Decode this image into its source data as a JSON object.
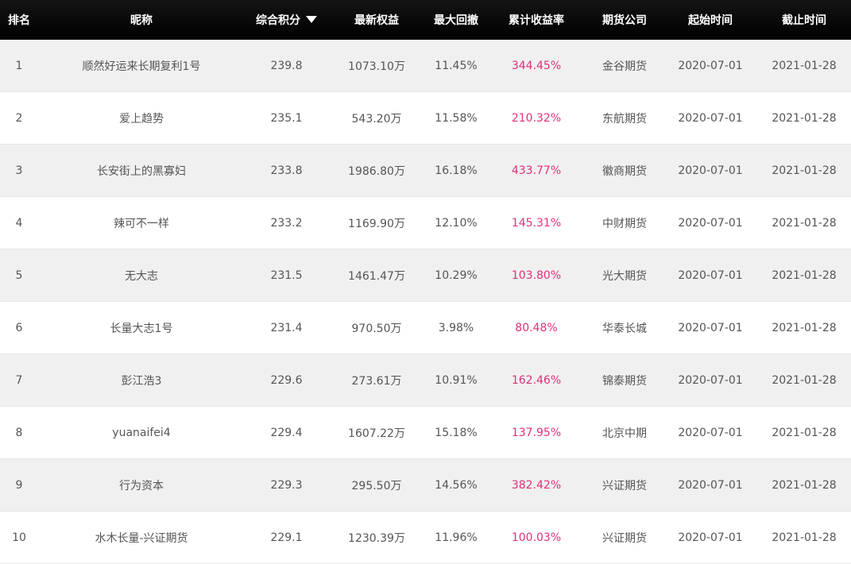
{
  "header": {
    "rank": "排名",
    "nickname": "昵称",
    "score": "综合积分",
    "equity": "最新权益",
    "drawdown": "最大回撤",
    "return": "累计收益率",
    "broker": "期货公司",
    "start": "起始时间",
    "end": "截止时间",
    "sort_icon": "caret-down-icon"
  },
  "colors": {
    "header_bg": "#000000",
    "return_text": "#e0307a",
    "stripe": "#f0f0f0"
  },
  "rows": [
    {
      "rank": "1",
      "nickname": "顺然好运来长期复利1号",
      "score": "239.8",
      "equity": "1073.10万",
      "drawdown": "11.45%",
      "return": "344.45%",
      "broker": "金谷期货",
      "start": "2020-07-01",
      "end": "2021-01-28"
    },
    {
      "rank": "2",
      "nickname": "爱上趋势",
      "score": "235.1",
      "equity": "543.20万",
      "drawdown": "11.58%",
      "return": "210.32%",
      "broker": "东航期货",
      "start": "2020-07-01",
      "end": "2021-01-28"
    },
    {
      "rank": "3",
      "nickname": "长安街上的黑寡妇",
      "score": "233.8",
      "equity": "1986.80万",
      "drawdown": "16.18%",
      "return": "433.77%",
      "broker": "徽商期货",
      "start": "2020-07-01",
      "end": "2021-01-28"
    },
    {
      "rank": "4",
      "nickname": "辣可不一样",
      "score": "233.2",
      "equity": "1169.90万",
      "drawdown": "12.10%",
      "return": "145.31%",
      "broker": "中财期货",
      "start": "2020-07-01",
      "end": "2021-01-28"
    },
    {
      "rank": "5",
      "nickname": "无大志",
      "score": "231.5",
      "equity": "1461.47万",
      "drawdown": "10.29%",
      "return": "103.80%",
      "broker": "光大期货",
      "start": "2020-07-01",
      "end": "2021-01-28"
    },
    {
      "rank": "6",
      "nickname": "长量大志1号",
      "score": "231.4",
      "equity": "970.50万",
      "drawdown": "3.98%",
      "return": "80.48%",
      "broker": "华泰长城",
      "start": "2020-07-01",
      "end": "2021-01-28"
    },
    {
      "rank": "7",
      "nickname": "彭江浩3",
      "score": "229.6",
      "equity": "273.61万",
      "drawdown": "10.91%",
      "return": "162.46%",
      "broker": "锦泰期货",
      "start": "2020-07-01",
      "end": "2021-01-28"
    },
    {
      "rank": "8",
      "nickname": "yuanaifei4",
      "score": "229.4",
      "equity": "1607.22万",
      "drawdown": "15.18%",
      "return": "137.95%",
      "broker": "北京中期",
      "start": "2020-07-01",
      "end": "2021-01-28"
    },
    {
      "rank": "9",
      "nickname": "行为资本",
      "score": "229.3",
      "equity": "295.50万",
      "drawdown": "14.56%",
      "return": "382.42%",
      "broker": "兴证期货",
      "start": "2020-07-01",
      "end": "2021-01-28"
    },
    {
      "rank": "10",
      "nickname": "水木长量-兴证期货",
      "score": "229.1",
      "equity": "1230.39万",
      "drawdown": "11.96%",
      "return": "100.03%",
      "broker": "兴证期货",
      "start": "2020-07-01",
      "end": "2021-01-28"
    }
  ]
}
